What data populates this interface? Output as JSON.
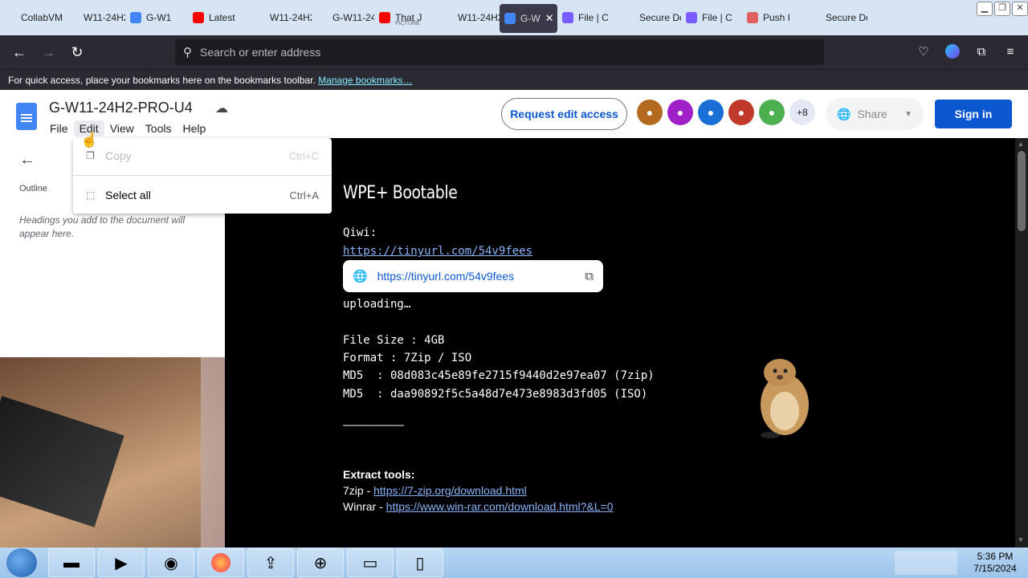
{
  "browser": {
    "tabs": [
      {
        "label": "CollabVM",
        "color": "#d6e4f4"
      },
      {
        "label": "W11-24H2",
        "color": "#d6e4f4"
      },
      {
        "label": "G-W1",
        "color": "#4285f4"
      },
      {
        "label": "Latest",
        "color": "#ff0000"
      },
      {
        "label": "W11-24H2",
        "color": "#d6e4f4"
      },
      {
        "label": "G-W11-24",
        "color": "#d6e4f4"
      },
      {
        "label": "That J",
        "sub": "PICTURE",
        "color": "#ff0000"
      },
      {
        "label": "W11-24H2",
        "color": "#d6e4f4"
      },
      {
        "label": "G-W",
        "color": "#4285f4",
        "active": true
      },
      {
        "label": "File | C",
        "color": "#7a5cff"
      },
      {
        "label": "Secure Do",
        "color": "#d6e4f4"
      },
      {
        "label": "File | C",
        "color": "#7a5cff"
      },
      {
        "label": "Push I",
        "color": "#e06060"
      },
      {
        "label": "Secure Do",
        "color": "#d6e4f4"
      }
    ],
    "tab_close_glyph": "✕",
    "window_buttons": {
      "minimize": "▁",
      "restore": "❐",
      "close": "✕"
    },
    "address_placeholder": "Search or enter address",
    "bookmarks_text": "For quick access, place your bookmarks here on the bookmarks toolbar.",
    "manage_bookmarks": "Manage bookmarks…"
  },
  "docs": {
    "title": "G-W11-24H2-PRO-U4",
    "menu": [
      "File",
      "Edit",
      "View",
      "Tools",
      "Help"
    ],
    "request_edit": "Request edit access",
    "avatars": [
      {
        "icon": "cat-icon",
        "color": "#b46a1e"
      },
      {
        "icon": "kiwi-icon",
        "color": "#a020c8"
      },
      {
        "icon": "octopus-icon",
        "color": "#1a6fd6"
      },
      {
        "icon": "shield-icon",
        "color": "#c0392b"
      },
      {
        "icon": "turtle-icon",
        "color": "#4caf50"
      }
    ],
    "more_count": "+8",
    "share": "Share",
    "sign_in": "Sign in"
  },
  "outline": {
    "label": "Outline",
    "hint": "Headings you add to the document will appear here."
  },
  "edit_menu": {
    "items": [
      {
        "label": "Copy",
        "shortcut": "Ctrl+C",
        "disabled": true
      },
      {
        "label": "Select all",
        "shortcut": "Ctrl+A",
        "disabled": false
      }
    ]
  },
  "document": {
    "heading": "WPE+ Bootable",
    "qiwi_label": "Qiwi:",
    "qiwi_link": "https://tinyurl.com/54v9fees",
    "link_card_url": "https://tinyurl.com/54v9fees",
    "uploading": "uploading…",
    "file_size": "File Size : 4GB",
    "format": "Format : 7Zip / ISO",
    "md5_zip": "MD5  : 08d083c45e89fe2715f9440d2e97ea07 (7zip)",
    "md5_iso": "MD5  : daa90892f5c5a48d7e473e8983d3fd05 (ISO)",
    "divider": "—————————",
    "extract_heading": "Extract tools:",
    "zip_label": "7zip - ",
    "zip_link": "https://7-zip.org/download.html",
    "rar_label": "Winrar - ",
    "rar_link": "https://www.win-rar.com/download.html?&L=0"
  },
  "taskbar": {
    "time": "5:36 PM",
    "date": "7/15/2024"
  }
}
